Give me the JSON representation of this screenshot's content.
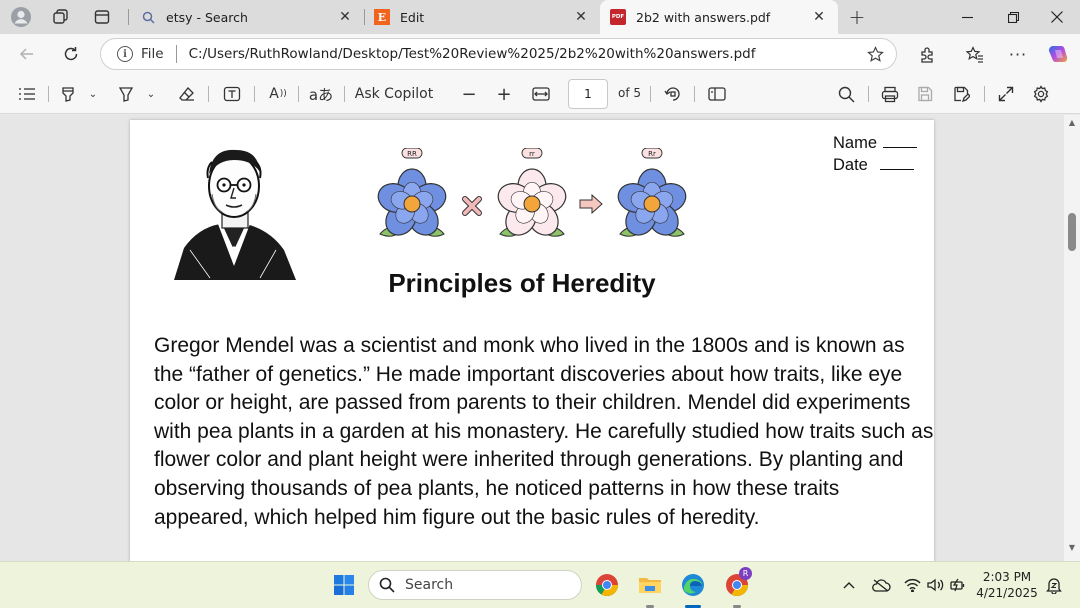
{
  "browser": {
    "tabs": [
      {
        "title": "etsy - Search",
        "favicon": "search-icon",
        "active": false
      },
      {
        "title": "Edit",
        "favicon": "etsy-E-logo",
        "favicon_letter": "E",
        "favicon_color": "#f1641e",
        "active": false
      },
      {
        "title": "2b2 with answers.pdf",
        "favicon": "pdf-icon",
        "favicon_letter": "PDF",
        "favicon_color": "#c4262e",
        "active": true
      }
    ],
    "address": {
      "scheme_label": "File",
      "url": "C:/Users/RuthRowland/Desktop/Test%20Review%2025/2b2%20with%20answers.pdf"
    }
  },
  "pdf_toolbar": {
    "ask_copilot": "Ask Copilot",
    "current_page": "1",
    "of_pages": "of 5"
  },
  "document": {
    "labels": {
      "name": "Name",
      "date": "Date"
    },
    "genotypes": [
      "RR",
      "rr",
      "Rr"
    ],
    "title": "Principles of Heredity",
    "body": "Gregor Mendel was a scientist and monk who lived in the 1800s and is known as the “father of genetics.” He made important discoveries about how traits, like eye color or height, are passed from parents to their children. Mendel did experiments with pea plants in a garden at his monastery. He carefully studied how traits such as flower color and plant height were inherited through generations. By planting and observing thousands of pea plants, he noticed patterns in how these traits appeared, which helped him figure out the basic rules of heredity."
  },
  "taskbar": {
    "search_label": "Search",
    "time": "2:03 PM",
    "date": "4/21/2025",
    "profile_initial": "R"
  },
  "colors": {
    "flower_blue": "#6f8fe0",
    "flower_white": "#fbe9ee",
    "accent_edge": "#0067c0",
    "taskbar_bg": "#eef4dc"
  }
}
